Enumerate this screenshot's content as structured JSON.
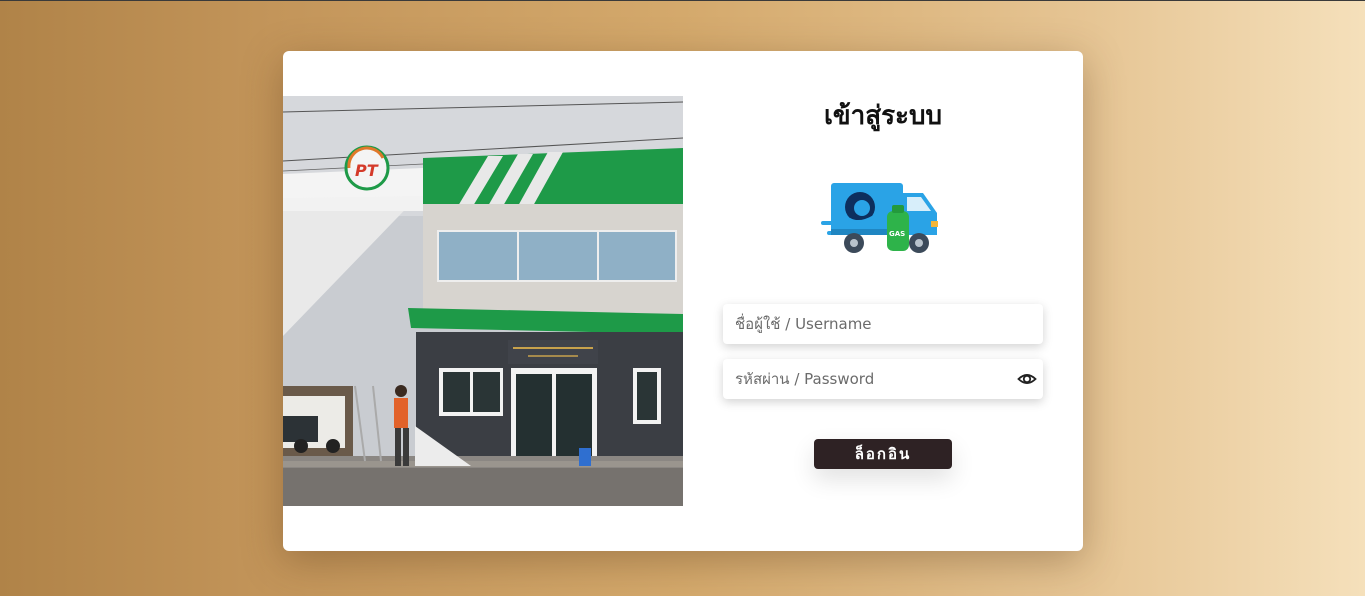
{
  "login": {
    "title": "เข้าสู่ระบบ",
    "username_placeholder": "ชื่อผู้ใช้ / Username",
    "password_placeholder": "รหัสผ่าน / Password",
    "login_button": "ล็อกอิน"
  },
  "logo": {
    "badge": "PT",
    "truck_text": "GAS"
  },
  "icons": {
    "password_toggle": "eye-icon",
    "logo_icon": "delivery-truck-icon"
  },
  "colors": {
    "button_bg": "#2e2224",
    "truck_blue": "#2aa3e6",
    "gas_green": "#2eb34a"
  }
}
